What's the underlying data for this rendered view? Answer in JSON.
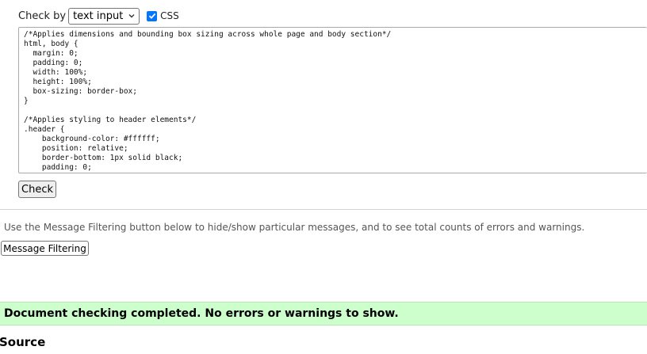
{
  "form": {
    "check_by_label": "Check by",
    "check_by_value": "text input",
    "css_checkbox_label": "CSS",
    "css_checked": true,
    "code_text": "/*Applies dimensions and bounding box sizing across whole page and body section*/\nhtml, body {\n  margin: 0;\n  padding: 0;\n  width: 100%;\n  height: 100%;\n  box-sizing: border-box;\n}\n\n/*Applies styling to header elements*/\n.header {\n    background-color: #ffffff;\n    position: relative;\n    border-bottom: 1px solid black;\n    padding: 0;",
    "check_button_label": "Check"
  },
  "filter": {
    "hint_text": "Use the Message Filtering button below to hide/show particular messages, and to see total counts of errors and warnings.",
    "button_label": "Message Filtering"
  },
  "result": {
    "message": "Document checking completed. No errors or warnings to show.",
    "status_color": "#ccffcc"
  },
  "source": {
    "heading": "Source"
  }
}
